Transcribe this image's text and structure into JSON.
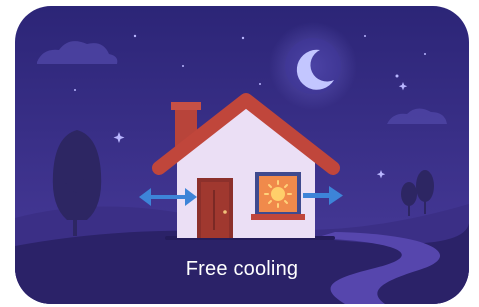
{
  "tile": {
    "label": "Free cooling",
    "scene": "house-at-night-with-airflow",
    "colors": {
      "sky_top": "#2c2577",
      "sky_bottom": "#4a3c9c",
      "hill_back": "#3c2f86",
      "hill_front": "#2a2266",
      "path": "#5a4ab3",
      "moon": "#bfc3ff",
      "roof": "#b8443a",
      "wall": "#e8dcf4",
      "door": "#8a2f2a",
      "window_sun": "#f2a23c",
      "arrow": "#3c82d6",
      "tree": "#2c2660"
    },
    "icons": [
      "moon-icon",
      "sun-icon",
      "left-arrow-icon",
      "right-arrow-icon"
    ]
  }
}
